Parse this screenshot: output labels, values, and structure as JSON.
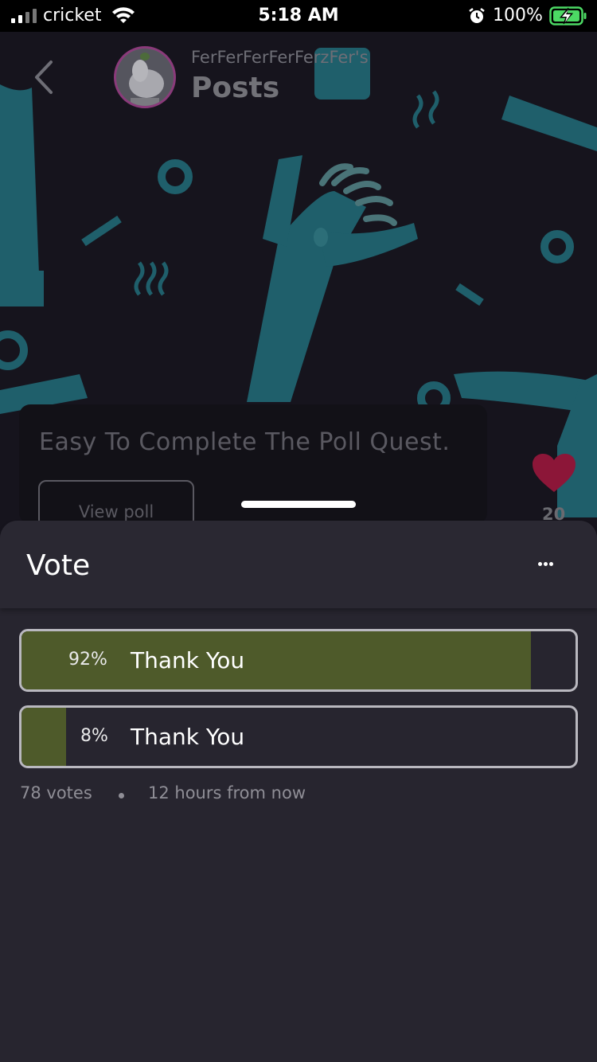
{
  "status_bar": {
    "carrier": "cricket",
    "time": "5:18 AM",
    "battery": "100%"
  },
  "header": {
    "owner": "FerFerFerFerFerzFer's",
    "title": "Posts"
  },
  "post": {
    "text": "Easy To Complete The Poll Quest.",
    "view_poll_label": "View poll",
    "like_count": "20"
  },
  "sheet": {
    "title": "Vote",
    "options": [
      {
        "percent_label": "92%",
        "label": "Thank You",
        "fraction": 0.92
      },
      {
        "percent_label": "8%",
        "label": "Thank You",
        "fraction": 0.08
      }
    ],
    "votes": "78 votes",
    "time_left": "12 hours from now"
  },
  "colors": {
    "vote_fill": "#4e5a2a",
    "heart": "#8c1638",
    "sheet_bg": "#27252f"
  },
  "icons": [
    "cellular-signal-icon",
    "wifi-icon",
    "alarm-icon",
    "battery-charging-icon",
    "back-chevron-icon",
    "heart-icon",
    "more-dots-icon"
  ]
}
